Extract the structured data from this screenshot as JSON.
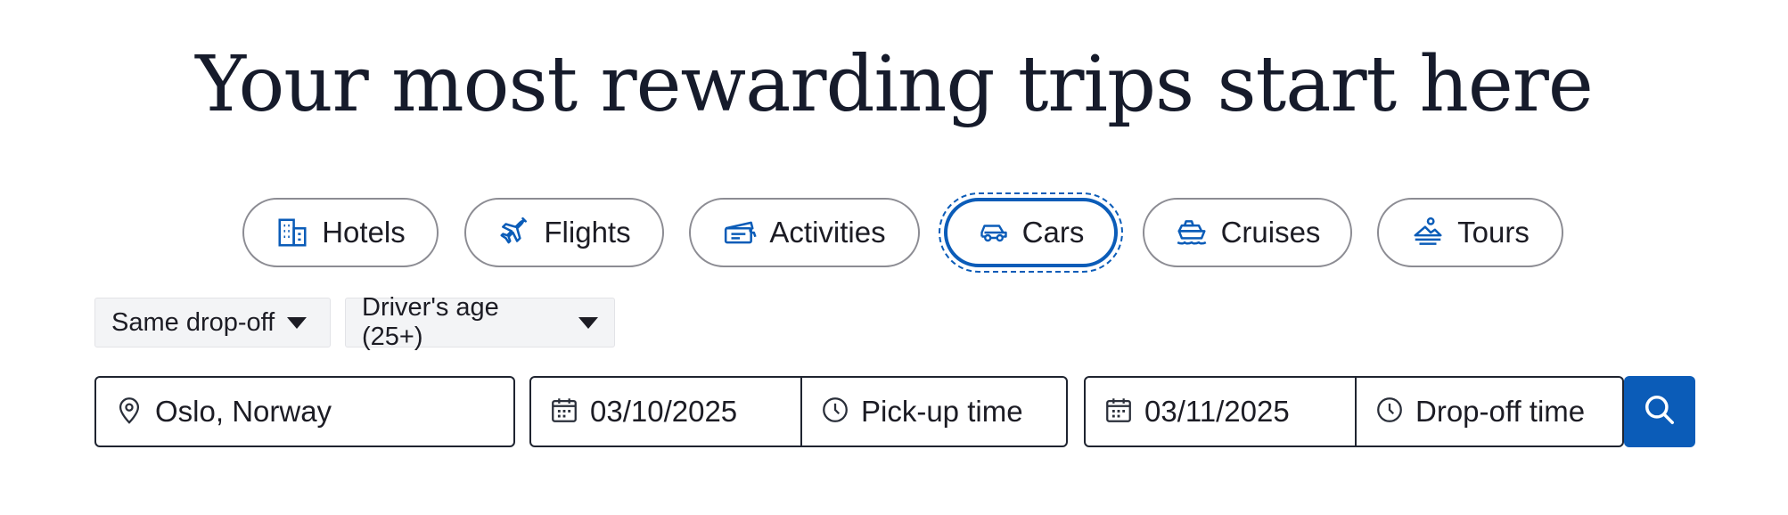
{
  "headline": "Your most rewarding trips start here",
  "tabs": [
    {
      "label": "Hotels",
      "icon": "hotel-icon"
    },
    {
      "label": "Flights",
      "icon": "airplane-icon"
    },
    {
      "label": "Activities",
      "icon": "ticket-icon"
    },
    {
      "label": "Cars",
      "icon": "car-icon",
      "active": true
    },
    {
      "label": "Cruises",
      "icon": "cruise-ship-icon"
    },
    {
      "label": "Tours",
      "icon": "tour-icon"
    }
  ],
  "filters": {
    "dropoff": {
      "label": "Same drop-off",
      "icon": "caret-down-icon"
    },
    "driver_age": {
      "label": "Driver's age (25+)",
      "icon": "caret-down-icon"
    }
  },
  "search": {
    "location": {
      "value": "Oslo, Norway",
      "icon": "map-pin-icon"
    },
    "pickup_date": {
      "value": "03/10/2025",
      "icon": "calendar-icon"
    },
    "pickup_time": {
      "value": "Pick-up time",
      "icon": "clock-icon"
    },
    "dropoff_date": {
      "value": "03/11/2025",
      "icon": "calendar-icon"
    },
    "dropoff_time": {
      "value": "Drop-off time",
      "icon": "clock-icon"
    },
    "button_icon": "search-icon"
  },
  "colors": {
    "accent": "#0b5cb8",
    "text": "#1c1c24",
    "border": "#8c8c93",
    "filter_bg": "#f3f4f6"
  }
}
